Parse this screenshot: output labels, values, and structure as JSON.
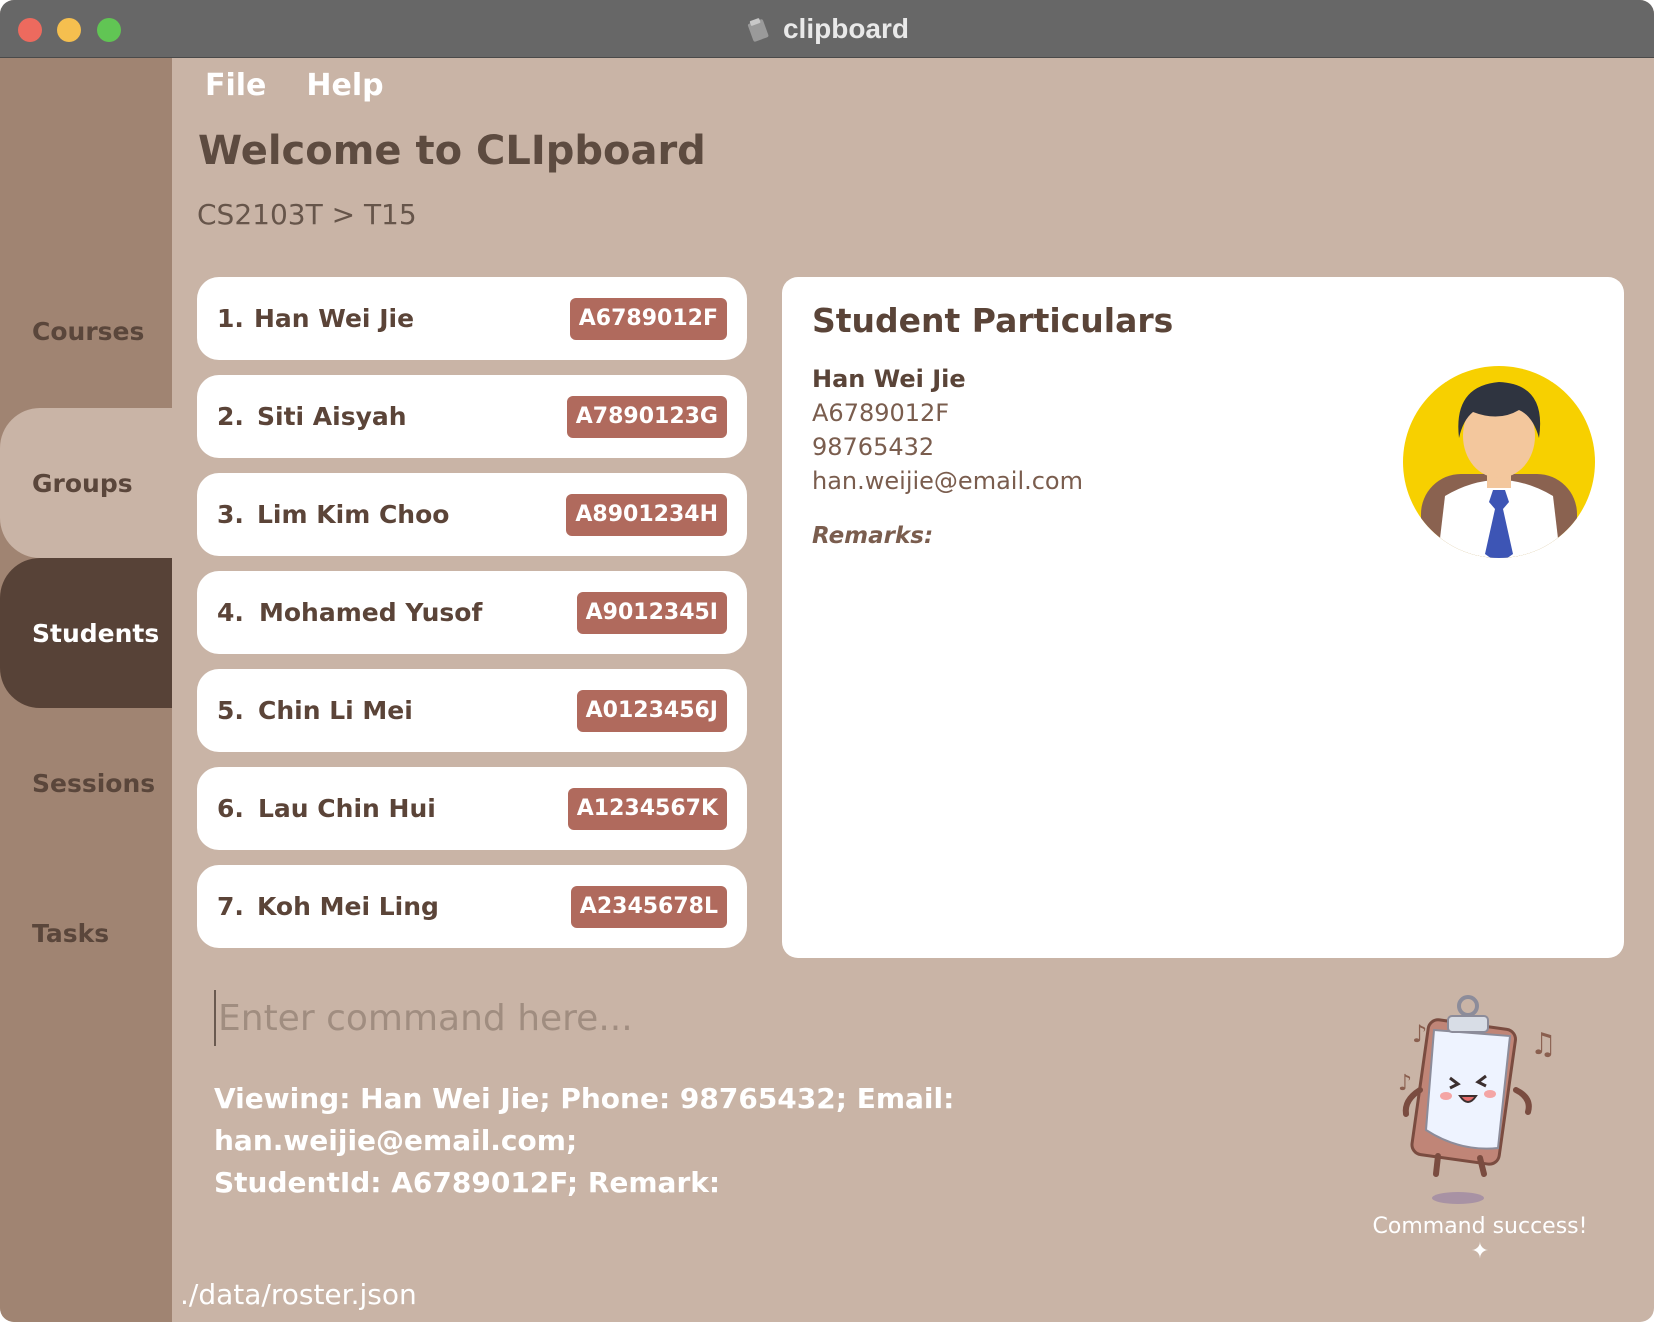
{
  "window": {
    "title": "clipboard"
  },
  "sidebar": {
    "items": [
      {
        "label": "Courses"
      },
      {
        "label": "Groups"
      },
      {
        "label": "Students"
      },
      {
        "label": "Sessions"
      },
      {
        "label": "Tasks"
      }
    ]
  },
  "menu": {
    "file": "File",
    "help": "Help"
  },
  "header": {
    "welcome": "Welcome to CLIpboard",
    "breadcrumb": "CS2103T > T15"
  },
  "students": [
    {
      "index": "1.",
      "name": "Han Wei Jie",
      "id": "A6789012F"
    },
    {
      "index": "2.",
      "name": "Siti Aisyah",
      "id": "A7890123G"
    },
    {
      "index": "3.",
      "name": "Lim Kim Choo",
      "id": "A8901234H"
    },
    {
      "index": "4.",
      "name": "Mohamed Yusof",
      "id": "A9012345I"
    },
    {
      "index": "5.",
      "name": "Chin Li Mei",
      "id": "A0123456J"
    },
    {
      "index": "6.",
      "name": "Lau Chin Hui",
      "id": "A1234567K"
    },
    {
      "index": "7.",
      "name": "Koh Mei Ling",
      "id": "A2345678L"
    }
  ],
  "particulars": {
    "heading": "Student Particulars",
    "name": "Han Wei Jie",
    "student_id": "A6789012F",
    "phone": "98765432",
    "email": "han.weijie@email.com",
    "remarks_label": "Remarks:"
  },
  "command": {
    "placeholder": "Enter command here..."
  },
  "result": {
    "line1": "Viewing: Han Wei Jie; Phone: 98765432; Email: han.weijie@email.com;",
    "line2": "StudentId: A6789012F; Remark:"
  },
  "mascot": {
    "status": "Command success! ✦"
  },
  "footer": {
    "file_path": "./data/roster.json"
  },
  "colors": {
    "background": "#c9b4a6",
    "sidebar": "#a08472",
    "sidebar_active": "#574237",
    "badge": "#b06a5d",
    "text_dark": "#5a4438"
  }
}
